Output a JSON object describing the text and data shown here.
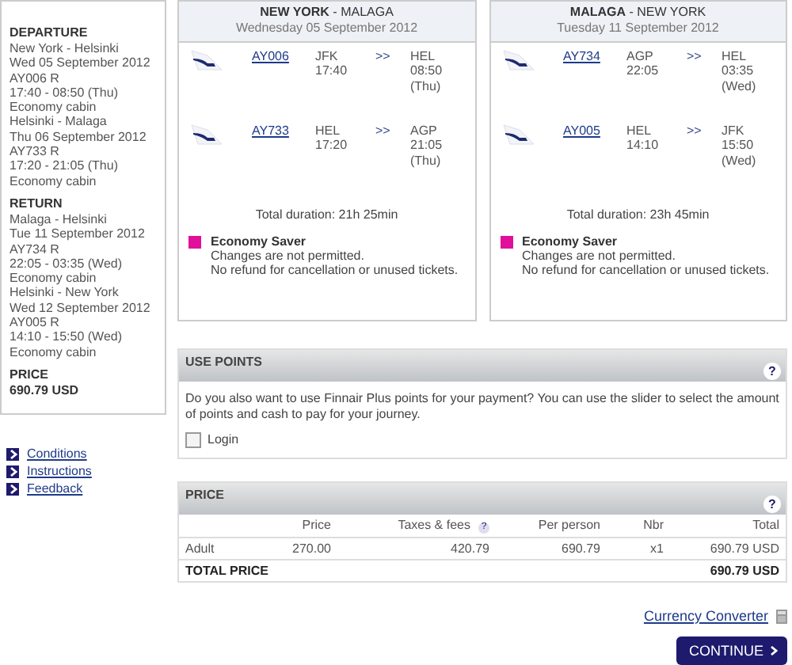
{
  "sidebar": {
    "sections": [
      {
        "heading": "DEPARTURE",
        "lines": [
          "New York - Helsinki",
          "Wed 05 September 2012",
          "AY006 R",
          "17:40 - 08:50 (Thu)",
          "Economy cabin",
          "Helsinki - Malaga",
          "Thu 06 September 2012",
          "AY733 R",
          "17:20 - 21:05 (Thu)",
          "Economy cabin"
        ]
      },
      {
        "heading": "RETURN",
        "lines": [
          "Malaga - Helsinki",
          "Tue 11 September 2012",
          "AY734 R",
          "22:05 - 03:35 (Wed)",
          "Economy cabin",
          "Helsinki - New York",
          "Wed 12 September 2012",
          "AY005 R",
          "14:10 - 15:50 (Wed)",
          "Economy cabin"
        ]
      }
    ],
    "price": {
      "heading": "PRICE",
      "value": "690.79 USD"
    },
    "links": [
      "Conditions",
      "Instructions",
      "Feedback"
    ]
  },
  "journeys": [
    {
      "route": "**NEW YORK** - MALAGA",
      "date": "Wednesday 05 September 2012",
      "flights": [
        {
          "number": "AY006",
          "from": "JFK",
          "dep": "17:40",
          "arrow": ">>",
          "to": "HEL",
          "arr": "08:50",
          "day": "(Thu)"
        },
        {
          "number": "AY733",
          "from": "HEL",
          "dep": "17:20",
          "arrow": ">>",
          "to": "AGP",
          "arr": "21:05",
          "day": "(Thu)"
        }
      ],
      "duration": "Total duration: 21h 25min",
      "fare": {
        "name": "Economy Saver",
        "color": "#e0109a",
        "lines": [
          "Changes are not permitted.",
          "No refund for cancellation or unused tickets."
        ]
      }
    },
    {
      "route": "**MALAGA** - NEW YORK",
      "date": "Tuesday 11 September 2012",
      "flights": [
        {
          "number": "AY734",
          "from": "AGP",
          "dep": "22:05",
          "arrow": ">>",
          "to": "HEL",
          "arr": "03:35",
          "day": "(Wed)"
        },
        {
          "number": "AY005",
          "from": "HEL",
          "dep": "14:10",
          "arrow": ">>",
          "to": "JFK",
          "arr": "15:50",
          "day": "(Wed)"
        }
      ],
      "duration": "Total duration: 23h 45min",
      "fare": {
        "name": "Economy Saver",
        "color": "#e0109a",
        "lines": [
          "Changes are not permitted.",
          "No refund for cancellation or unused tickets."
        ]
      }
    }
  ],
  "use_points": {
    "title": "USE POINTS",
    "help": "?",
    "text": "Do you also want to use Finnair Plus points for your payment? You can use the slider to select the amount of points and cash to pay for your journey.",
    "login": {
      "label": "Login",
      "checked": false
    }
  },
  "price": {
    "title": "PRICE",
    "help": "?",
    "columns": [
      "Price",
      "Taxes & fees",
      "Per person",
      "Nbr",
      "Total"
    ],
    "taxes_help": "?",
    "rows": [
      {
        "label": "Adult",
        "cells": [
          "270.00",
          "420.79",
          "690.79",
          "x1",
          "690.79 USD"
        ]
      }
    ],
    "total": {
      "label": "TOTAL PRICE",
      "value": "690.79 USD"
    }
  },
  "currency_converter": "Currency Converter",
  "continue": "CONTINUE"
}
